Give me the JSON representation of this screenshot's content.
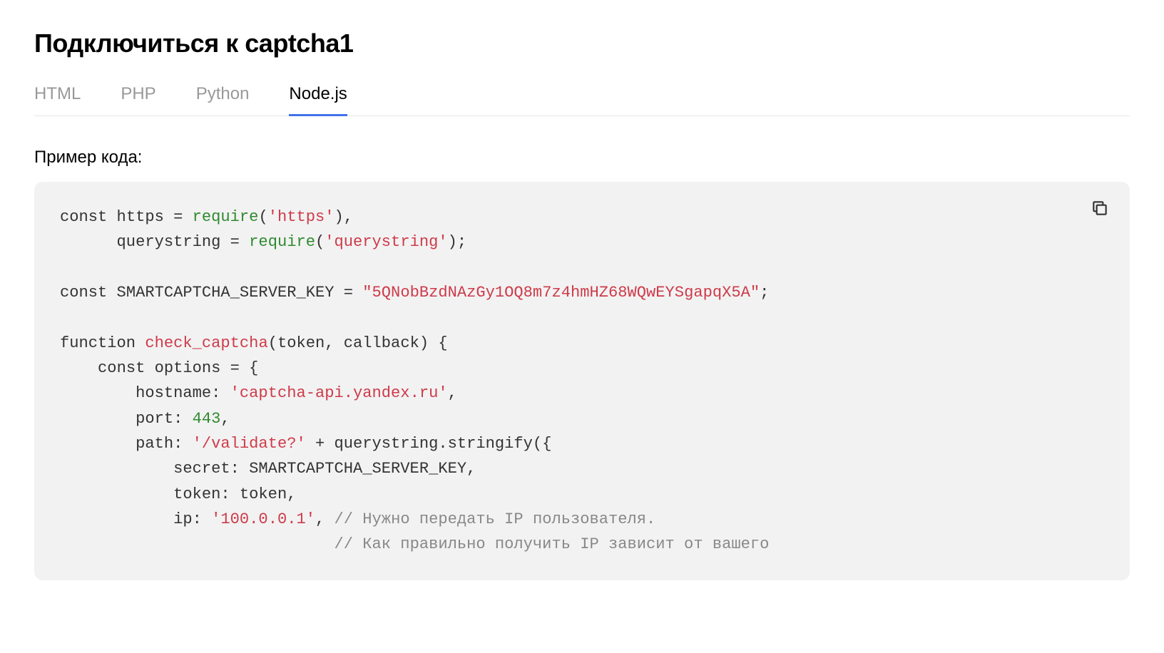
{
  "page_title": "Подключиться к captcha1",
  "tabs": [
    {
      "label": "HTML",
      "active": false
    },
    {
      "label": "PHP",
      "active": false
    },
    {
      "label": "Python",
      "active": false
    },
    {
      "label": "Node.js",
      "active": true
    }
  ],
  "example_label": "Пример кода:",
  "code": {
    "l1": {
      "kw1": "const",
      "id1": " https = ",
      "fn1": "require",
      "p1": "(",
      "s1": "'https'",
      "p2": "),"
    },
    "l2": {
      "id1": "      querystring = ",
      "fn1": "require",
      "p1": "(",
      "s1": "'querystring'",
      "p2": ");"
    },
    "l3": "",
    "l4": {
      "kw1": "const",
      "id1": " SMARTCAPTCHA_SERVER_KEY = ",
      "s1": "\"5QNobBzdNAzGy1OQ8m7z4hmHZ68WQwEYSgapqX5A\"",
      "p1": ";"
    },
    "l5": "",
    "l6": {
      "kw1": "function",
      "sp": " ",
      "fn1": "check_captcha",
      "p1": "(token, callback) {"
    },
    "l7": {
      "p1": "    ",
      "kw1": "const",
      "p2": " options = {"
    },
    "l8": {
      "p1": "        hostname: ",
      "s1": "'captcha-api.yandex.ru'",
      "p2": ","
    },
    "l9": {
      "p1": "        port: ",
      "n1": "443",
      "p2": ","
    },
    "l10": {
      "p1": "        path: ",
      "s1": "'/validate?'",
      "p2": " + querystring.stringify({"
    },
    "l11": {
      "p1": "            secret: SMARTCAPTCHA_SERVER_KEY,"
    },
    "l12": {
      "p1": "            token: token,"
    },
    "l13": {
      "p1": "            ip: ",
      "s1": "'100.0.0.1'",
      "p2": ", ",
      "c1": "// Нужно передать IP пользователя."
    },
    "l14": {
      "p1": "                             ",
      "c1": "// Как правильно получить IP зависит от вашего"
    }
  }
}
